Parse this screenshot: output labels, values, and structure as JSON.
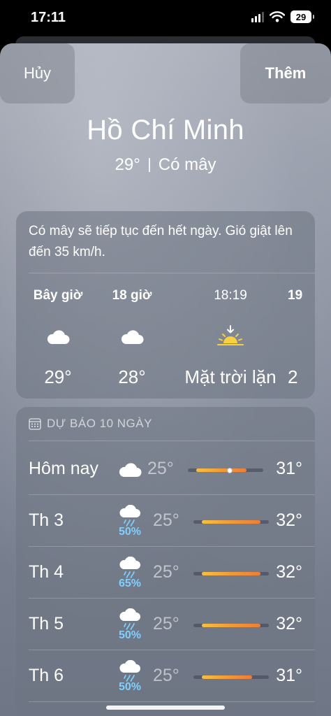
{
  "status_bar": {
    "time": "17:11",
    "battery": "29"
  },
  "header": {
    "cancel_label": "Hủy",
    "add_label": "Thêm"
  },
  "location": {
    "city": "Hồ Chí Minh",
    "temperature": "29°",
    "condition": "Có mây"
  },
  "hourly": {
    "summary": "Có mây sẽ tiếp tục đến hết ngày. Gió giật lên đến 35 km/h.",
    "items": [
      {
        "label": "Bây giờ",
        "icon": "cloud-icon",
        "value": "29°"
      },
      {
        "label": "18 giờ",
        "icon": "cloud-icon",
        "value": "28°"
      },
      {
        "label": "18:19",
        "icon": "sunset-icon",
        "value": "Mặt trời lặn"
      },
      {
        "label": "19",
        "icon": "cloud-icon",
        "value": "2"
      }
    ]
  },
  "daily": {
    "header": "DỰ BÁO 10 NGÀY",
    "scale": {
      "min": 24,
      "max": 33
    },
    "rows": [
      {
        "day": "Hôm nay",
        "icon": "cloud-icon",
        "pop": "",
        "low": "25°",
        "high": "31°",
        "low_value": 25,
        "high_value": 31,
        "current_value": 29
      },
      {
        "day": "Th 3",
        "icon": "cloud-rain-icon",
        "pop": "50%",
        "low": "25°",
        "high": "32°",
        "low_value": 25,
        "high_value": 32
      },
      {
        "day": "Th 4",
        "icon": "cloud-rain-icon",
        "pop": "65%",
        "low": "25°",
        "high": "32°",
        "low_value": 25,
        "high_value": 32
      },
      {
        "day": "Th 5",
        "icon": "cloud-rain-icon",
        "pop": "50%",
        "low": "25°",
        "high": "32°",
        "low_value": 25,
        "high_value": 32
      },
      {
        "day": "Th 6",
        "icon": "cloud-rain-icon",
        "pop": "50%",
        "low": "25°",
        "high": "31°",
        "low_value": 25,
        "high_value": 31
      }
    ]
  },
  "colors": {
    "precipitation": "#7fd0ff",
    "sun": "#f7d23e",
    "bar_warm": "#f29a38"
  }
}
